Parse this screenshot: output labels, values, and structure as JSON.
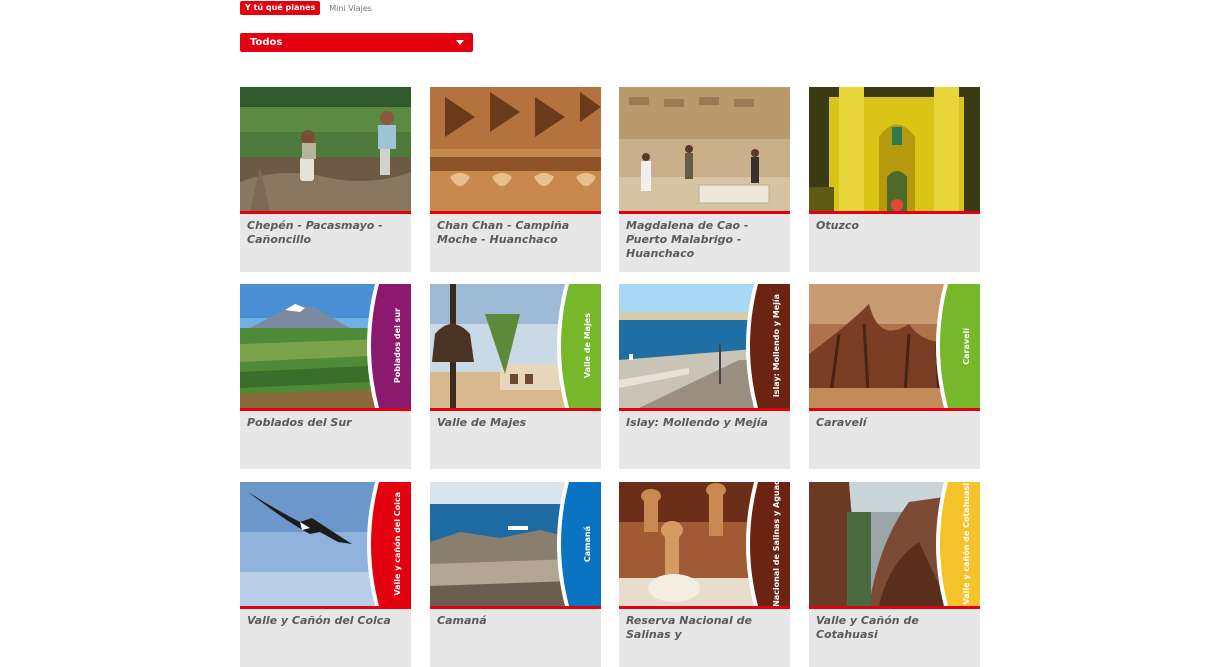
{
  "tabs": {
    "active": "Y tú qué planes",
    "inactive": "Mini Viajes"
  },
  "filter": {
    "selected": "Todos"
  },
  "cards": [
    {
      "title": "Chepén - Pacasmayo - Cañoncillo",
      "scene": "people-rocks"
    },
    {
      "title": "Chan Chan - Campiña Moche - Huanchaco",
      "scene": "adobe"
    },
    {
      "title": "Magdalena de Cao - Puerto Malabrigo - Huanchaco",
      "scene": "ruins"
    },
    {
      "title": "Otuzco",
      "scene": "church"
    },
    {
      "title": "Poblados del Sur",
      "scene": "volcano",
      "band": "Poblados del sur",
      "band_color": "#8b1a6e"
    },
    {
      "title": "Valle de Majes",
      "scene": "bell",
      "band": "Valle de Majes",
      "band_color": "#76b82a"
    },
    {
      "title": "Islay: Mollendo y Mejía",
      "scene": "coast",
      "band": "Islay: Mollendo y Mejía",
      "band_color": "#6b2412"
    },
    {
      "title": "Caravelí",
      "scene": "forest",
      "band": "Caravelí",
      "band_color": "#76b82a"
    },
    {
      "title": "Valle y Cañón del Colca",
      "scene": "condor",
      "band": "Valle y cañón del Colca",
      "band_color": "#e3000f"
    },
    {
      "title": "Camaná",
      "scene": "sea-rocks",
      "band": "Camaná",
      "band_color": "#0a74c2"
    },
    {
      "title": "Reserva Nacional de Salinas y",
      "scene": "vicunas",
      "band": "Reserva Nacional de Salinas y Aguada Blanca",
      "band_color": "#6b2412"
    },
    {
      "title": "Valle y Cañón de Cotahuasi",
      "scene": "canyon",
      "band": "Valle y cañón de Cotahuasi",
      "band_color": "#f5c32c"
    }
  ]
}
